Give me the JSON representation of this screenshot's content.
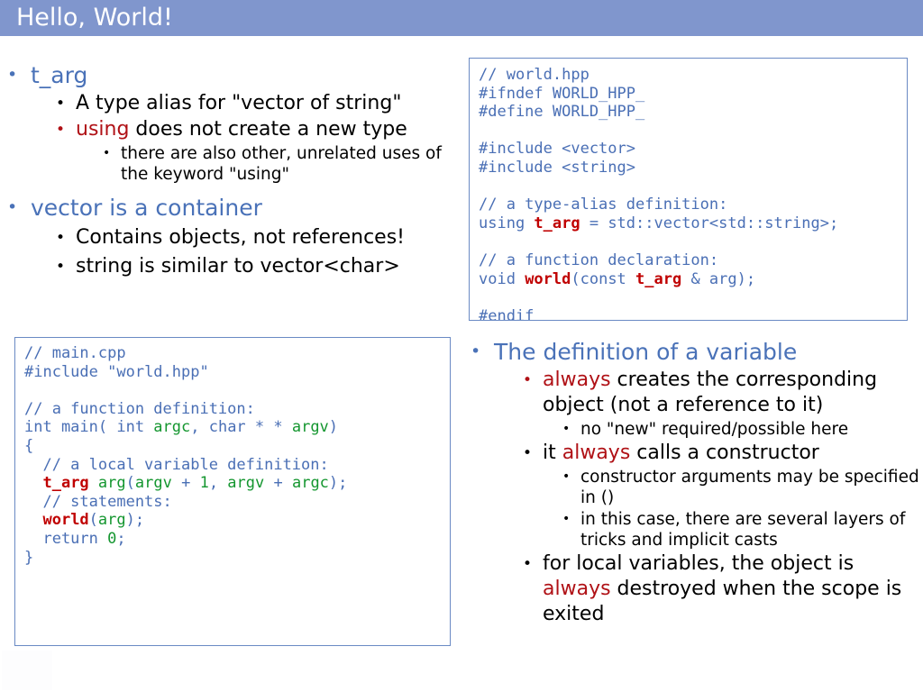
{
  "slide": {
    "title": "Hello, World!",
    "title_bar_color": "#8096cd",
    "accent_blue": "#4a72b8",
    "accent_red": "#b01116",
    "code_blue": "#4a6fb5",
    "code_green": "#14962f",
    "code_red": "#c00000",
    "bullet_glyph": "•"
  },
  "left_bullets": [
    {
      "level": 1,
      "text": "t_arg"
    },
    {
      "level": 2,
      "text": "A type alias for \"vector of string\""
    },
    {
      "level": 2,
      "red_word": "using",
      "text": " does not create a new type",
      "red_dot": true
    },
    {
      "level": 3,
      "text": "there are also other, unrelated uses of the keyword \"using\""
    },
    {
      "level": 1,
      "text": "vector is a container"
    },
    {
      "level": 2,
      "text": "Contains objects, not references!"
    },
    {
      "level": 2,
      "text": "string is similar to vector<char>"
    }
  ],
  "right_bullets": [
    {
      "level": 1,
      "text": "The definition of a variable"
    },
    {
      "level": 2,
      "red_word": "always",
      "text": " creates the corresponding object (not a reference to it)",
      "red_dot": true
    },
    {
      "level": 3,
      "text": "no \"new\" required/possible here"
    },
    {
      "level": 2,
      "pre_text": "it ",
      "red_word": "always",
      "text": " calls a constructor"
    },
    {
      "level": 3,
      "text": "constructor arguments may be specified in ()"
    },
    {
      "level": 3,
      "text": "in this case, there are several layers of tricks and implicit casts"
    },
    {
      "level": 2,
      "text": "for local variables, the object is ",
      "red_word_after": "always",
      "text_after": " destroyed when the scope is exited"
    }
  ],
  "code_world_hpp": {
    "filename": "world.hpp",
    "lines": [
      "// world.hpp",
      "#ifndef WORLD_HPP_",
      "#define WORLD_HPP_",
      "",
      "#include <vector>",
      "#include <string>",
      "",
      "// a type-alias definition:",
      "using t_arg = std::vector<std::string>;",
      "",
      "// a function declaration:",
      "void world(const t_arg & arg);",
      "",
      "#endif"
    ]
  },
  "code_main_cpp": {
    "filename": "main.cpp",
    "lines": [
      "// main.cpp",
      "#include \"world.hpp\"",
      "",
      "// a function definition:",
      "int main( int argc, char * * argv)",
      "{",
      "  // a local variable definition:",
      "  t_arg arg(argv + 1, argv + argc);",
      "  // statements:",
      "  world(arg);",
      "  return 0;",
      "}"
    ]
  }
}
